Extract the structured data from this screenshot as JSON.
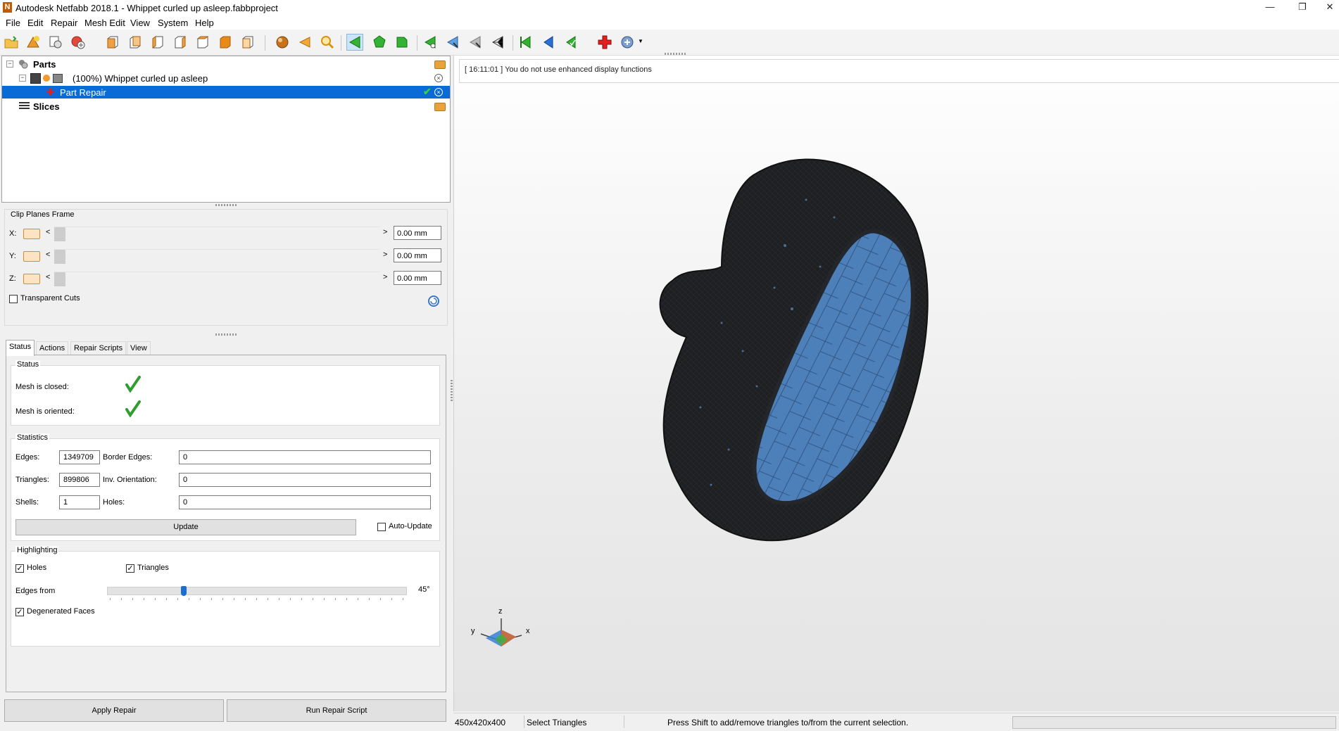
{
  "window": {
    "title": "Autodesk Netfabb 2018.1 - Whippet curled up asleep.fabbproject",
    "logo_letter": "N"
  },
  "menu": [
    "File",
    "Edit",
    "Repair",
    "Mesh Edit",
    "View",
    "System",
    "Help"
  ],
  "tree": {
    "parts_label": "Parts",
    "part_label": "(100%) Whippet curled up asleep",
    "repair_label": "Part Repair",
    "slices_label": "Slices"
  },
  "clip_planes": {
    "title": "Clip Planes Frame",
    "axes": [
      {
        "axis": "X:",
        "value": "0.00 mm"
      },
      {
        "axis": "Y:",
        "value": "0.00 mm"
      },
      {
        "axis": "Z:",
        "value": "0.00 mm"
      }
    ],
    "transparent_cuts_label": "Transparent Cuts",
    "transparent_cuts_checked": false
  },
  "tabs": [
    "Status",
    "Actions",
    "Repair Scripts",
    "View"
  ],
  "active_tab": "Status",
  "status_group": {
    "title": "Status",
    "mesh_closed_label": "Mesh is closed:",
    "mesh_oriented_label": "Mesh is oriented:"
  },
  "statistics": {
    "title": "Statistics",
    "edges_label": "Edges:",
    "edges_value": "1349709",
    "triangles_label": "Triangles:",
    "triangles_value": "899806",
    "shells_label": "Shells:",
    "shells_value": "1",
    "border_edges_label": "Border Edges:",
    "border_edges_value": "0",
    "inv_orientation_label": "Inv. Orientation:",
    "inv_orientation_value": "0",
    "holes_label": "Holes:",
    "holes_value": "0",
    "update_label": "Update",
    "auto_update_label": "Auto-Update",
    "auto_update_checked": false
  },
  "highlighting": {
    "title": "Highlighting",
    "holes_label": "Holes",
    "triangles_label": "Triangles",
    "edges_from_label": "Edges from",
    "edges_from_value": "45°",
    "edges_from_fraction": 0.25,
    "degenerated_label": "Degenerated Faces"
  },
  "buttons": {
    "apply_repair": "Apply Repair",
    "run_repair_script": "Run Repair Script"
  },
  "log": {
    "message": "[ 16:11:01 ] You do not use enhanced display functions"
  },
  "axis_gizmo": {
    "z": "z",
    "y": "y",
    "x": "x"
  },
  "statusbar": {
    "dimensions": "450x420x400",
    "mode": "Select Triangles",
    "hint": "Press Shift to add/remove triangles to/from the current selection."
  },
  "colors": {
    "selection": "#0a6ad6",
    "mesh_dark": "#1e1f21",
    "mesh_cut": "#4d7fb8",
    "check_green": "#2e9e2e"
  }
}
